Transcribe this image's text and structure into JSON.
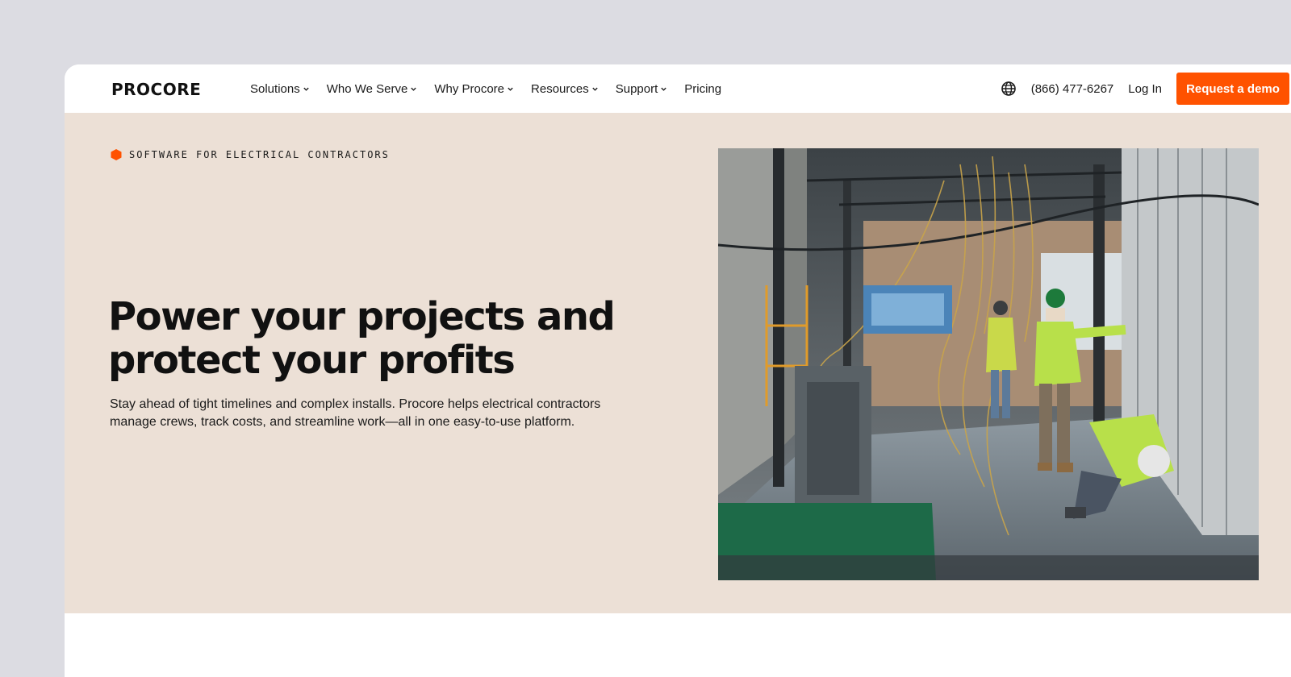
{
  "brand": {
    "logo_text": "PROCORE",
    "accent_color": "#ff5200"
  },
  "nav": {
    "items": [
      {
        "label": "Solutions",
        "dropdown": true
      },
      {
        "label": "Who We Serve",
        "dropdown": true
      },
      {
        "label": "Why Procore",
        "dropdown": true
      },
      {
        "label": "Resources",
        "dropdown": true
      },
      {
        "label": "Support",
        "dropdown": true
      },
      {
        "label": "Pricing",
        "dropdown": false
      }
    ],
    "phone": "(866) 477-6267",
    "login_label": "Log In",
    "demo_label": "Request a demo"
  },
  "hero": {
    "eyebrow": "SOFTWARE FOR ELECTRICAL CONTRACTORS",
    "headline_line1": "Power your projects and",
    "headline_line2": "protect your profits",
    "subtext": "Stay ahead of tight timelines and complex installs. Procore helps electrical contractors manage crews, track costs, and streamline work—all in one easy-to-use platform.",
    "background_color": "#ece0d6"
  }
}
